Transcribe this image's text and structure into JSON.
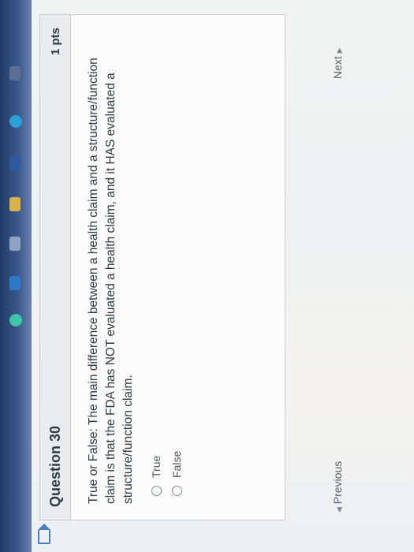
{
  "question": {
    "title": "Question 30",
    "points": "1 pts",
    "text": "True or False: The main difference between a health claim and a structure/function claim is that the FDA has NOT evaluated a health claim, and it HAS evaluated a structure/function claim.",
    "answers": [
      "True",
      "False"
    ]
  },
  "navigation": {
    "previous_label": "Previous",
    "next_label": "Next"
  },
  "icons": {
    "bookmark": "bookmark-icon",
    "previous_arrow": "triangle-left-icon",
    "next_arrow": "triangle-right-icon"
  },
  "colors": {
    "accent": "#4a7fc0",
    "text": "#2d3b45",
    "header_bg": "#e9ecee"
  }
}
